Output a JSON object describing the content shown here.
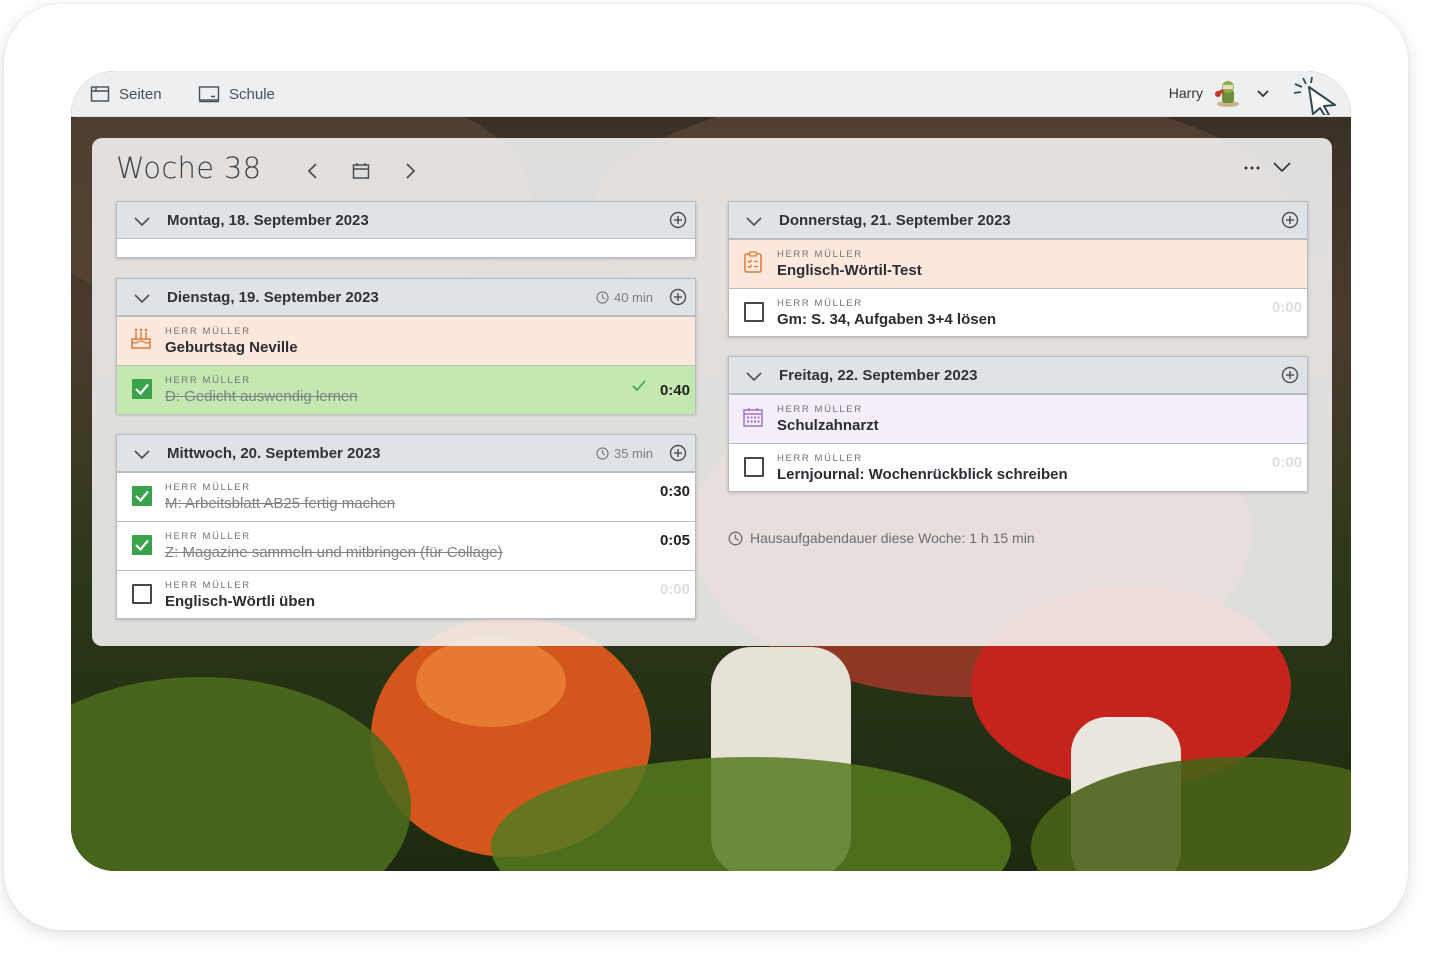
{
  "nav": {
    "pages_label": "Seiten",
    "school_label": "Schule"
  },
  "user": {
    "name": "Harry"
  },
  "week": {
    "title": "Woche 38"
  },
  "days": {
    "mon": {
      "title": "Montag, 18. September 2023",
      "duration": "",
      "tasks": []
    },
    "tue": {
      "title": "Dienstag, 19. September 2023",
      "duration": "40 min",
      "tasks": [
        {
          "teacher": "HERR MÜLLER",
          "name": "Geburtstag Neville",
          "kind": "birthday-event"
        },
        {
          "teacher": "HERR MÜLLER",
          "name": "D: Gedicht auswendig lernen",
          "time": "0:40",
          "done": true
        }
      ]
    },
    "wed": {
      "title": "Mittwoch, 20. September 2023",
      "duration": "35 min",
      "tasks": [
        {
          "teacher": "HERR MÜLLER",
          "name": "M: Arbeitsblatt AB25 fertig machen",
          "time": "0:30",
          "done": true
        },
        {
          "teacher": "HERR MÜLLER",
          "name": "Z: Magazine sammeln und mitbringen (für Collage)",
          "time": "0:05",
          "done": true
        },
        {
          "teacher": "HERR MÜLLER",
          "name": "Englisch-Wörtli üben",
          "time": "0:00",
          "done": false
        }
      ]
    },
    "thu": {
      "title": "Donnerstag, 21. September 2023",
      "duration": "",
      "tasks": [
        {
          "teacher": "HERR MÜLLER",
          "name": "Englisch-Wörtil-Test",
          "kind": "test-event"
        },
        {
          "teacher": "HERR MÜLLER",
          "name": "Gm: S. 34, Aufgaben 3+4 lösen",
          "time": "0:00",
          "done": false
        }
      ]
    },
    "fri": {
      "title": "Freitag, 22. September 2023",
      "duration": "",
      "tasks": [
        {
          "teacher": "HERR MÜLLER",
          "name": "Schulzahnarzt",
          "kind": "appointment-event"
        },
        {
          "teacher": "HERR MÜLLER",
          "name": "Lernjournal: Wochenrückblick schreiben",
          "time": "0:00",
          "done": false
        }
      ]
    }
  },
  "summary": {
    "text": "Hausaufgabendauer diese Woche: 1 h 15 min"
  },
  "colors": {
    "done_green": "#38a34a",
    "done_row": "#c3e8b0",
    "event_row": "#fde8de",
    "appointment_row": "#f3eef8",
    "header_grey": "#dfe2e6"
  }
}
